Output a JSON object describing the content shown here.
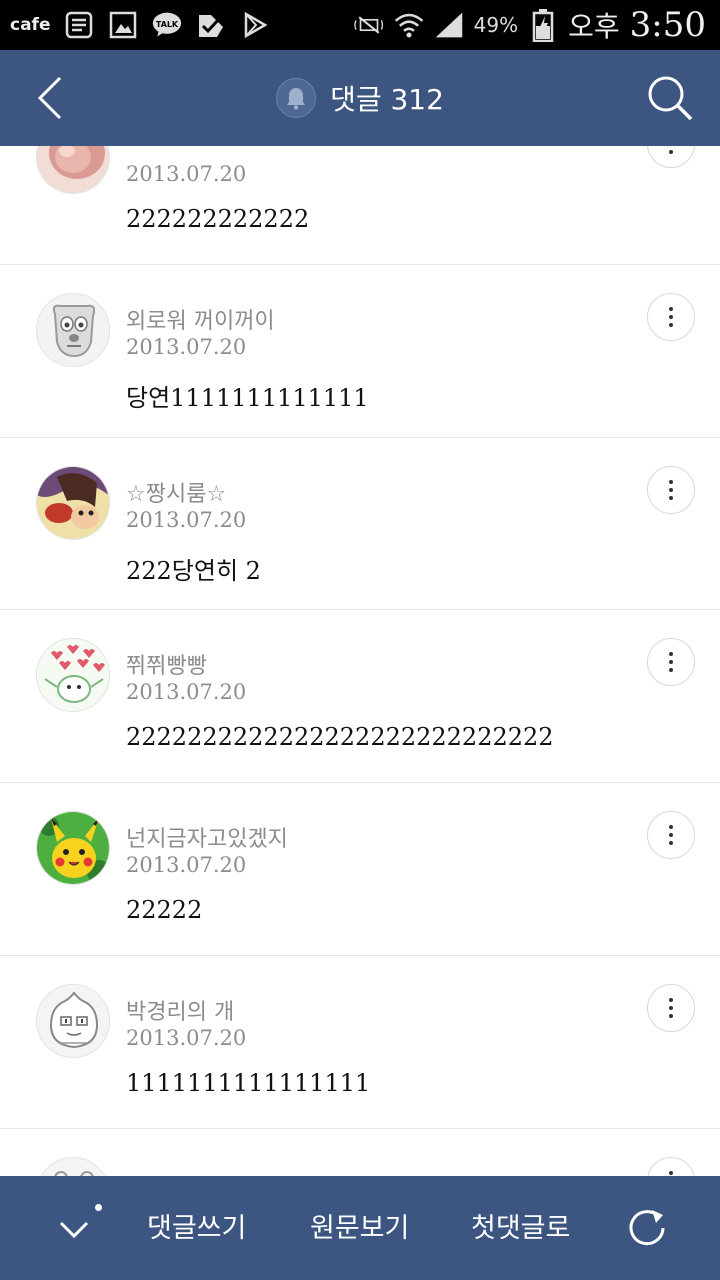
{
  "status_bar": {
    "app_label": "cafe",
    "talk_label": "TALK",
    "battery_percent": "49%",
    "ampm": "오후",
    "time": "3:50"
  },
  "header": {
    "title": "댓글 312",
    "bg_color": "#3d5681"
  },
  "comments": [
    {
      "author": "",
      "date": "2013.07.20",
      "text": "222222222222",
      "avatar_icon": "pink-avatar"
    },
    {
      "author": "외로워 꺼이꺼이",
      "date": "2013.07.20",
      "text": "당연1111111111111",
      "avatar_icon": "dog-sketch-avatar"
    },
    {
      "author": "☆짱시룸☆",
      "date": "2013.07.20",
      "text": "222당연히 2",
      "avatar_icon": "cartoon-face-avatar"
    },
    {
      "author": "쮜쮜빵빵",
      "date": "2013.07.20",
      "text": "2222222222222222222222222222",
      "avatar_icon": "hearts-avatar"
    },
    {
      "author": "넌지금자고있겠지",
      "date": "2013.07.20",
      "text": "22222",
      "avatar_icon": "pikachu-avatar"
    },
    {
      "author": "박경리의 개",
      "date": "2013.07.20",
      "text": "1111111111111111",
      "avatar_icon": "character-sketch-avatar"
    },
    {
      "author": "",
      "date": "",
      "text": "",
      "avatar_icon": "cropped-avatar"
    }
  ],
  "bottom_bar": {
    "write_comment": "댓글쓰기",
    "view_original": "원문보기",
    "to_first_comment": "첫댓글로"
  }
}
